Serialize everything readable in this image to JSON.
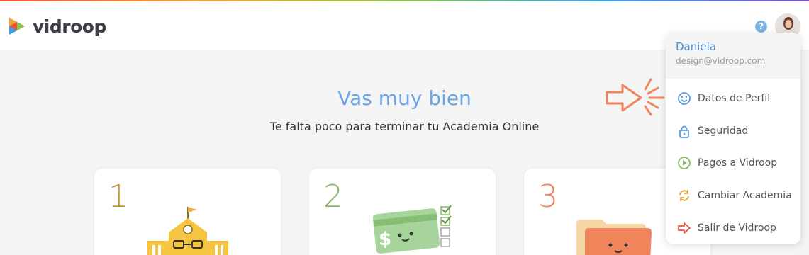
{
  "header": {
    "logo_text": "vidroop",
    "help_icon_glyph": "?"
  },
  "hero": {
    "title": "Vas muy bien",
    "subtitle": "Te falta poco para terminar tu Academia Online"
  },
  "cards": [
    {
      "number": "1",
      "color": "#c39a3b",
      "icon": "school-building-icon"
    },
    {
      "number": "2",
      "color": "#8ab866",
      "icon": "money-checklist-icon"
    },
    {
      "number": "3",
      "color": "#f0845a",
      "icon": "folder-icon"
    }
  ],
  "user_menu": {
    "name": "Daniela",
    "email": "design@vidroop.com",
    "items": [
      {
        "label": "Datos de Perfil",
        "icon": "smiley-icon",
        "color": "#5b9be3"
      },
      {
        "label": "Seguridad",
        "icon": "lock-icon",
        "color": "#5b9be3"
      },
      {
        "label": "Pagos a Vidroop",
        "icon": "play-circle-icon",
        "color": "#8ab866"
      },
      {
        "label": "Cambiar Academia",
        "icon": "refresh-icon",
        "color": "#e0a43d"
      },
      {
        "label": "Salir de Vidroop",
        "icon": "exit-arrow-icon",
        "color": "#e8543b"
      }
    ]
  },
  "colors": {
    "accent_blue": "#6ca4e8",
    "pointer_orange": "#f0845a"
  }
}
